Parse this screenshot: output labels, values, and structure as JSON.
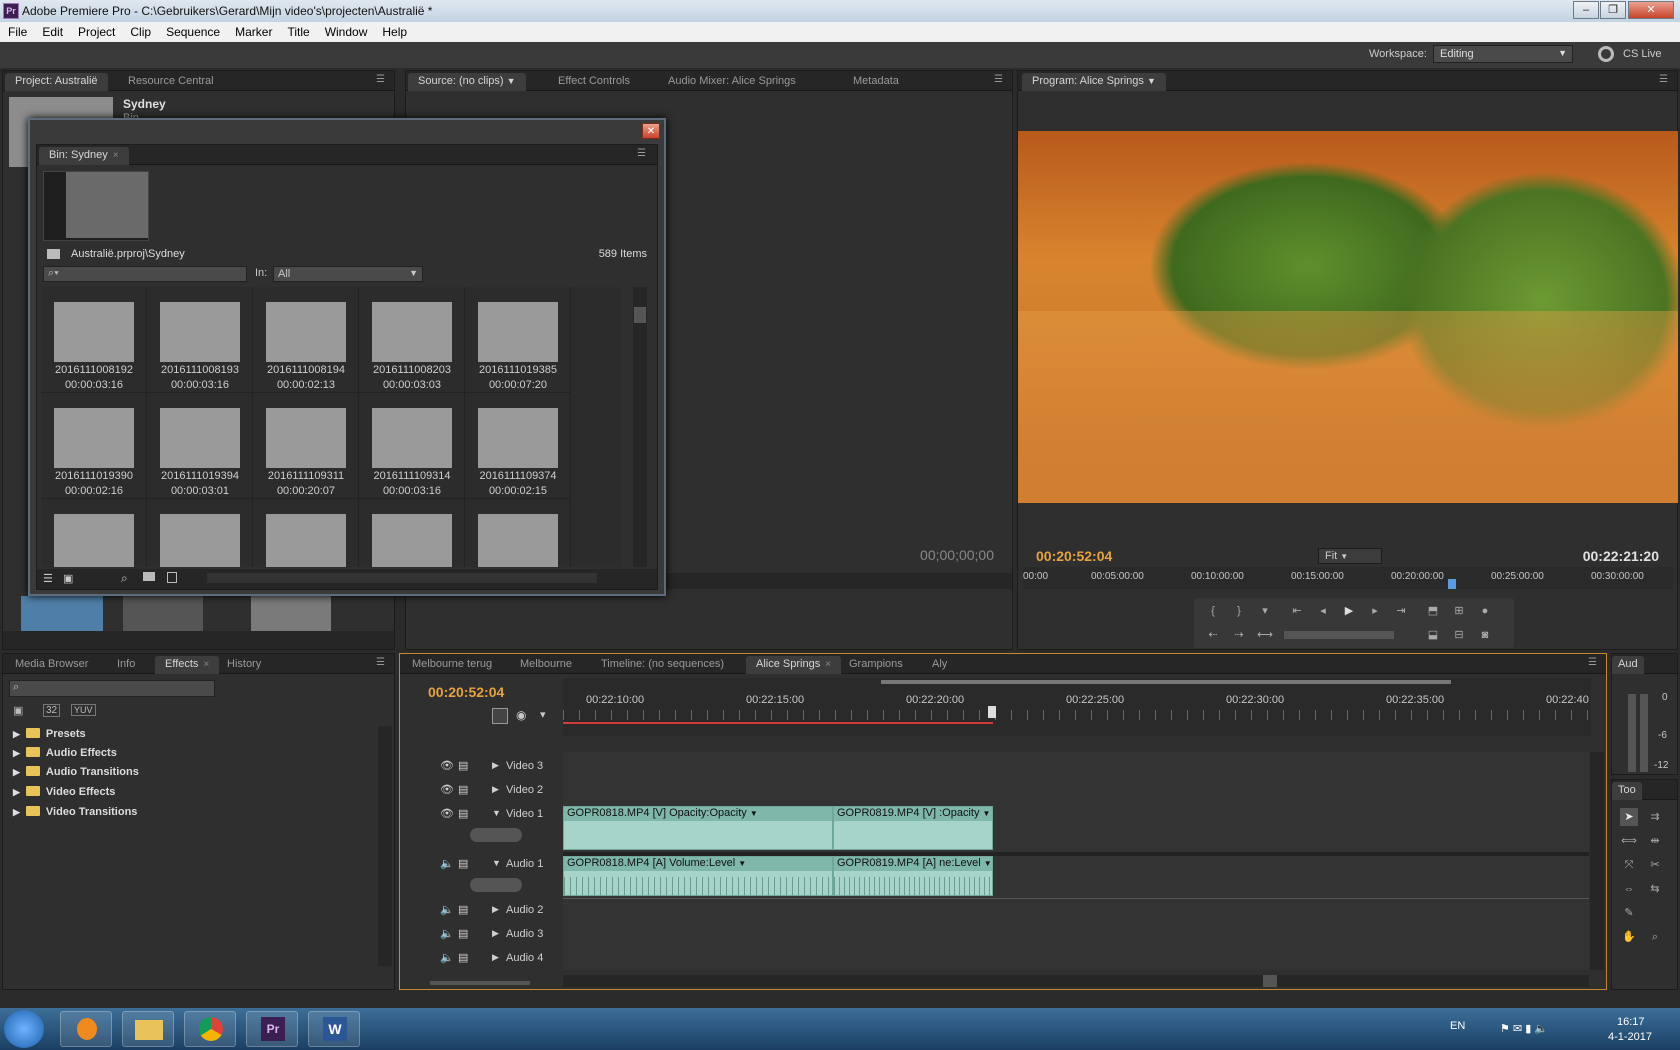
{
  "window": {
    "title": "Adobe Premiere Pro - C:\\Gebruikers\\Gerard\\Mijn video's\\projecten\\Australië *",
    "app_icon": "Pr"
  },
  "menu": [
    "File",
    "Edit",
    "Project",
    "Clip",
    "Sequence",
    "Marker",
    "Title",
    "Window",
    "Help"
  ],
  "workspace": {
    "label": "Workspace:",
    "value": "Editing",
    "cslive": "CS Live"
  },
  "project_panel": {
    "tabs": [
      "Project: Australië",
      "Resource Central"
    ],
    "bin_name": "Sydney",
    "bin_sub": "Bin"
  },
  "bin_window": {
    "tab": "Bin: Sydney",
    "path": "Australië.prproj\\Sydney",
    "count": "589 Items",
    "in_label": "In:",
    "in_value": "All",
    "items": [
      {
        "name": "2016111008192",
        "dur": "00:00:03:16"
      },
      {
        "name": "2016111008193",
        "dur": "00:00:03:16"
      },
      {
        "name": "2016111008194",
        "dur": "00:00:02:13"
      },
      {
        "name": "2016111008203",
        "dur": "00:00:03:03"
      },
      {
        "name": "2016111019385",
        "dur": "00:00:07:20"
      },
      {
        "name": "2016111019390",
        "dur": "00:00:02:16"
      },
      {
        "name": "2016111019394",
        "dur": "00:00:03:01"
      },
      {
        "name": "2016111109311",
        "dur": "00:00:20:07"
      },
      {
        "name": "2016111109314",
        "dur": "00:00:03:16"
      },
      {
        "name": "2016111109374",
        "dur": "00:00:02:15"
      }
    ]
  },
  "source_panel": {
    "tabs": [
      "Source: (no clips)",
      "Effect Controls",
      "Audio Mixer: Alice Springs",
      "Metadata"
    ],
    "timecode": "00;00;00;00"
  },
  "program_panel": {
    "tab": "Program: Alice Springs",
    "timecode": "00:20:52:04",
    "duration": "00:22:21:20",
    "fit": "Fit",
    "ruler": [
      "00:00",
      "00:05:00:00",
      "00:10:00:00",
      "00:15:00:00",
      "00:20:00:00",
      "00:25:00:00",
      "00:30:00:00"
    ]
  },
  "effects_panel": {
    "tabs": [
      "Media Browser",
      "Info",
      "Effects",
      "History"
    ],
    "presets_buttons": [
      "32",
      "YUV"
    ],
    "tree": [
      "Presets",
      "Audio Effects",
      "Audio Transitions",
      "Video Effects",
      "Video Transitions"
    ]
  },
  "timeline": {
    "tabs": [
      "Melbourne terug",
      "Melbourne",
      "Timeline: (no sequences)",
      "Alice Springs",
      "Grampions",
      "Aly"
    ],
    "timecode": "00:20:52:04",
    "ruler": [
      "00:22:10:00",
      "00:22:15:00",
      "00:22:20:00",
      "00:22:25:00",
      "00:22:30:00",
      "00:22:35:00",
      "00:22:40"
    ],
    "tracks": [
      "Video 3",
      "Video 2",
      "Video 1",
      "Audio 1",
      "Audio 2",
      "Audio 3",
      "Audio 4"
    ],
    "clips": [
      {
        "label": "GOPR0818.MP4 [V]",
        "fx": "Opacity:Opacity"
      },
      {
        "label": "GOPR0819.MP4 [V]",
        "fx": ":Opacity"
      },
      {
        "label": "GOPR0818.MP4 [A]",
        "fx": "Volume:Level"
      },
      {
        "label": "GOPR0819.MP4 [A]",
        "fx": "ne:Level"
      }
    ]
  },
  "audio_meter": {
    "tab": "Aud",
    "marks": [
      "0",
      "-6",
      "-12"
    ]
  },
  "tools": {
    "tab": "Too"
  },
  "taskbar": {
    "lang": "EN",
    "time": "16:17",
    "date": "4-1-2017"
  },
  "colors": {
    "timecode": "#e8a33b",
    "clip": "#a6d4c8",
    "panel": "#2f2f2f"
  }
}
